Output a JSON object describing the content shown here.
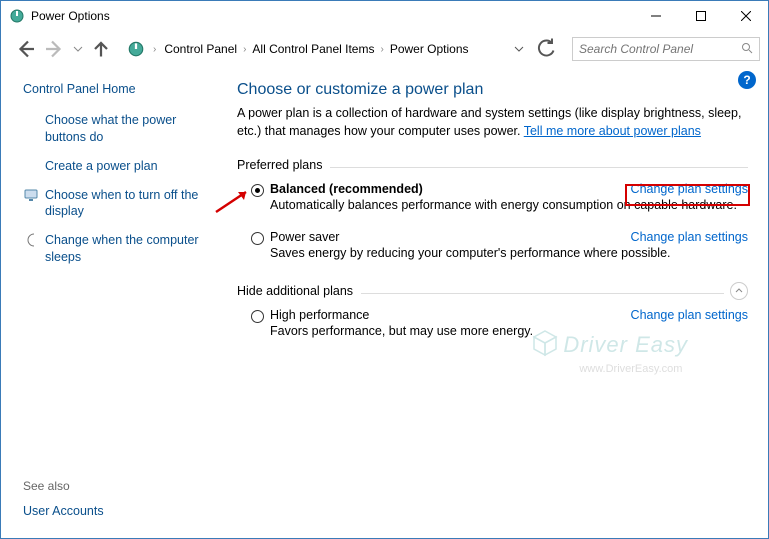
{
  "window": {
    "title": "Power Options"
  },
  "nav": {
    "breadcrumb": [
      "Control Panel",
      "All Control Panel Items",
      "Power Options"
    ],
    "search_placeholder": "Search Control Panel"
  },
  "sidebar": {
    "home": "Control Panel Home",
    "items": [
      {
        "label": "Choose what the power buttons do"
      },
      {
        "label": "Create a power plan"
      },
      {
        "label": "Choose when to turn off the display"
      },
      {
        "label": "Change when the computer sleeps"
      }
    ],
    "see_also_label": "See also",
    "see_also": "User Accounts"
  },
  "main": {
    "heading": "Choose or customize a power plan",
    "desc1": "A power plan is a collection of hardware and system settings (like display brightness, sleep, etc.) that manages how your computer uses power. ",
    "desc_link": "Tell me more about power plans",
    "preferred_label": "Preferred plans",
    "hide_label": "Hide additional plans",
    "change_link": "Change plan settings",
    "plans": [
      {
        "name": "Balanced (recommended)",
        "desc": "Automatically balances performance with energy consumption on capable hardware.",
        "selected": true
      },
      {
        "name": "Power saver",
        "desc": "Saves energy by reducing your computer's performance where possible.",
        "selected": false
      }
    ],
    "additional": [
      {
        "name": "High performance",
        "desc": "Favors performance, but may use more energy.",
        "selected": false
      }
    ]
  },
  "watermark": {
    "brand": "Driver Easy",
    "url": "www.DriverEasy.com"
  }
}
